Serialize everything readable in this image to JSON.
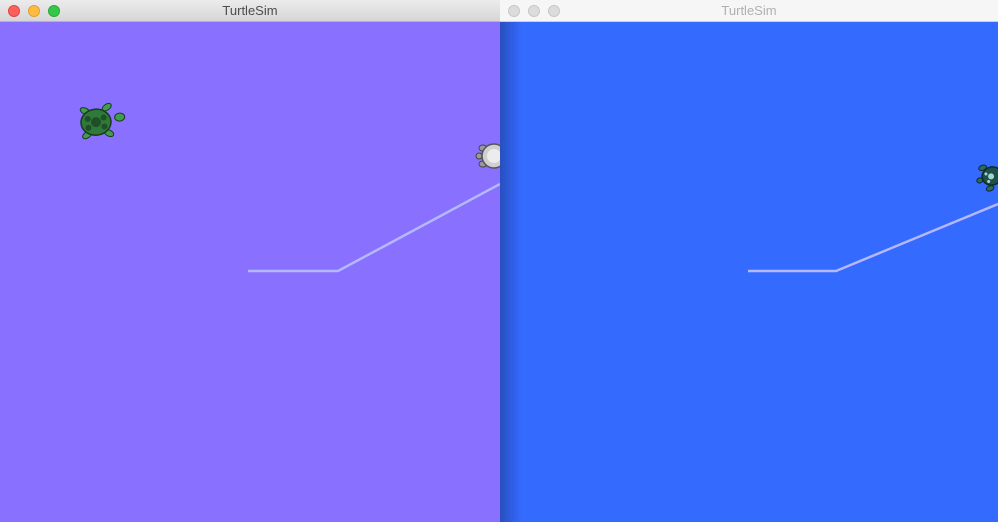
{
  "windows": [
    {
      "title": "TurtleSim",
      "focused": true,
      "background_color": "#8970fe",
      "turtles": [
        "green-turtle-icon",
        "gray-turtle-icon"
      ]
    },
    {
      "title": "TurtleSim",
      "focused": false,
      "background_color": "#356aff",
      "turtles": [
        "teal-turtle-icon"
      ]
    }
  ],
  "colors": {
    "pen_trail": "#b4b8ff",
    "traffic_close": "#fc605c",
    "traffic_minimize": "#fdbc40",
    "traffic_zoom": "#34c84a"
  }
}
